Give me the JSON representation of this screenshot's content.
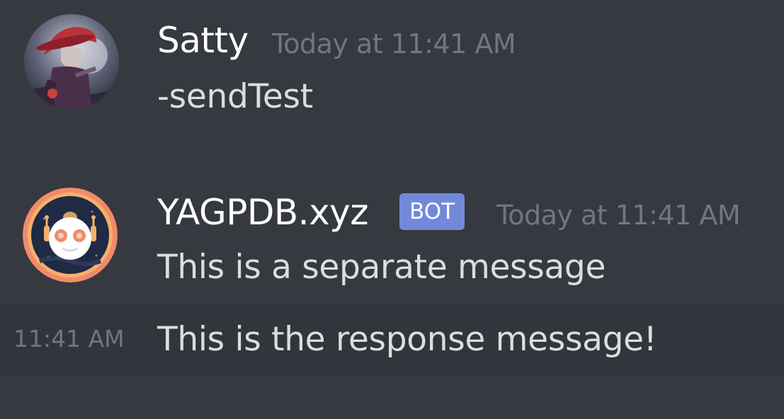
{
  "messages": [
    {
      "author": "Satty",
      "timestamp": "Today at 11:41 AM",
      "content": "-sendTest",
      "avatar_icon": "user-avatar-icon"
    },
    {
      "author": "YAGPDB.xyz",
      "badge": "BOT",
      "timestamp": "Today at 11:41 AM",
      "content": "This is a separate message",
      "avatar_icon": "bot-avatar-icon",
      "followup": {
        "side_time": "11:41 AM",
        "content": "This is the response message!"
      }
    }
  ],
  "colors": {
    "background": "#36393f",
    "hover_row": "#32353b",
    "username": "#ffffff",
    "text": "#dcddde",
    "muted": "#72767d",
    "bot_badge": "#7289da"
  }
}
